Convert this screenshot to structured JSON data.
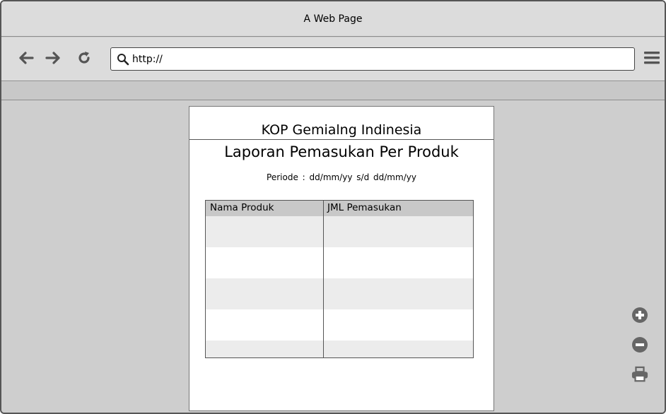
{
  "window": {
    "title": "A Web Page"
  },
  "toolbar": {
    "back_icon": "arrow-left-icon",
    "forward_icon": "arrow-right-icon",
    "reload_icon": "reload-icon",
    "address_value": "http://",
    "menu_icon": "hamburger-menu-icon"
  },
  "report": {
    "kop": "KOP Gemialng Indinesia",
    "title": "Laporan Pemasukan Per Produk",
    "periode_label": "Periode :",
    "date_from": "dd/mm/yy",
    "separator": "s/d",
    "date_to": "dd/mm/yy",
    "table": {
      "columns": [
        "Nama Produk",
        "JML Pemasukan"
      ],
      "rows": [
        [
          "",
          ""
        ],
        [
          "",
          ""
        ],
        [
          "",
          ""
        ],
        [
          "",
          ""
        ],
        [
          "",
          ""
        ]
      ]
    }
  },
  "side_tools": [
    "zoom-in-icon",
    "zoom-out-icon",
    "print-icon"
  ],
  "colors": {
    "chrome": "#dcdcdc",
    "canvas": "#cecece",
    "header_row": "#c8c8c8",
    "alt_row": "#ececec",
    "icon": "#666666"
  }
}
